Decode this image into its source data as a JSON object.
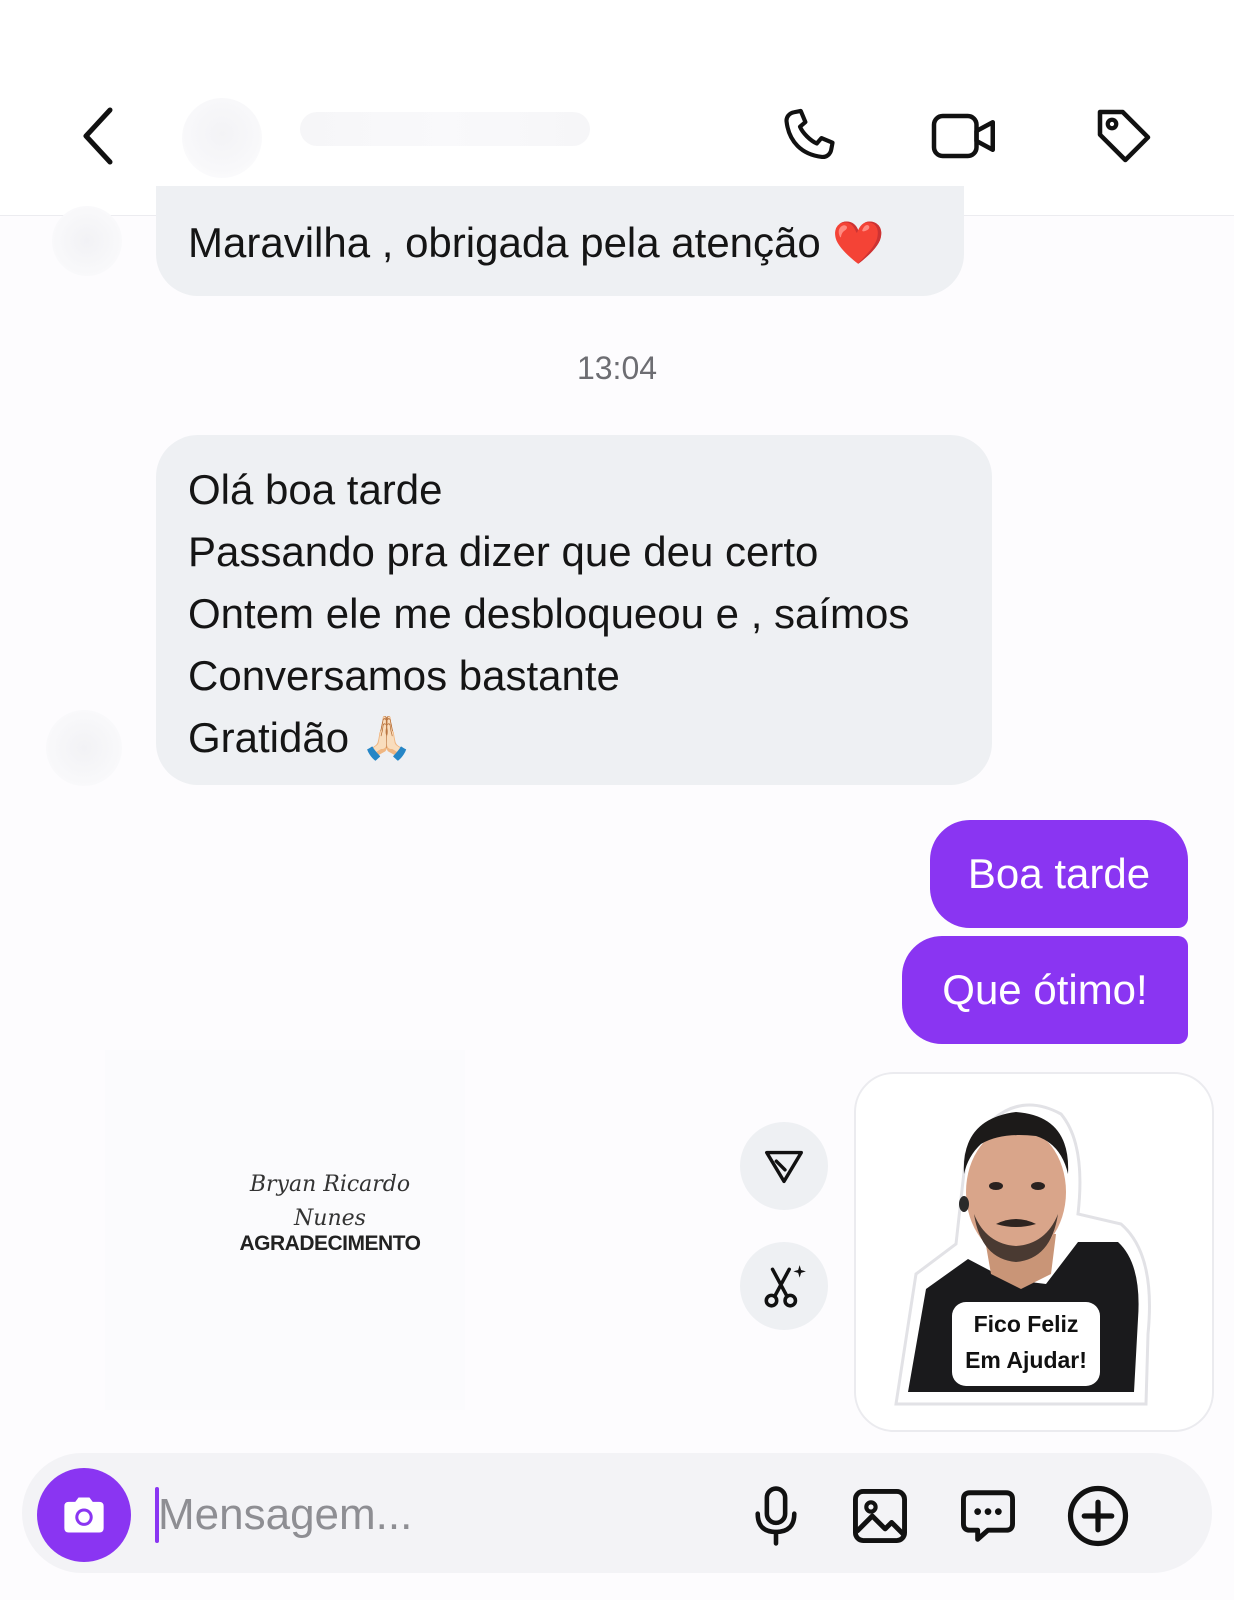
{
  "header": {
    "back_icon": "chevron-left-icon",
    "call_icon": "phone-icon",
    "video_icon": "video-camera-icon",
    "tag_icon": "tag-icon"
  },
  "messages": {
    "incoming_1": "Maravilha , obrigada pela atenção ❤️",
    "timestamp": "13:04",
    "incoming_2_lines": [
      "Olá boa tarde",
      "Passando pra dizer que deu certo",
      "Ontem ele me desbloqueou e , saímos",
      "Conversamos bastante",
      "Gratidão 🙏🏻"
    ],
    "outgoing_1": "Boa tarde",
    "outgoing_2": "Que ótimo!"
  },
  "sticker": {
    "caption_line1": "Fico Feliz",
    "caption_line2": "Em Ajudar!"
  },
  "watermark": {
    "script_line1": "Bryan Ricardo",
    "script_line2": "Nunes",
    "title": "AGRADECIMENTO"
  },
  "composer": {
    "placeholder": "Mensagem...",
    "camera_icon": "camera-icon",
    "mic_icon": "microphone-icon",
    "gallery_icon": "image-icon",
    "sticker_icon": "chat-bubble-icon",
    "add_icon": "plus-circle-icon"
  },
  "colors": {
    "accent": "#8a35f2",
    "incoming_bubble": "#eef0f3",
    "background": "#fdfcfe"
  }
}
